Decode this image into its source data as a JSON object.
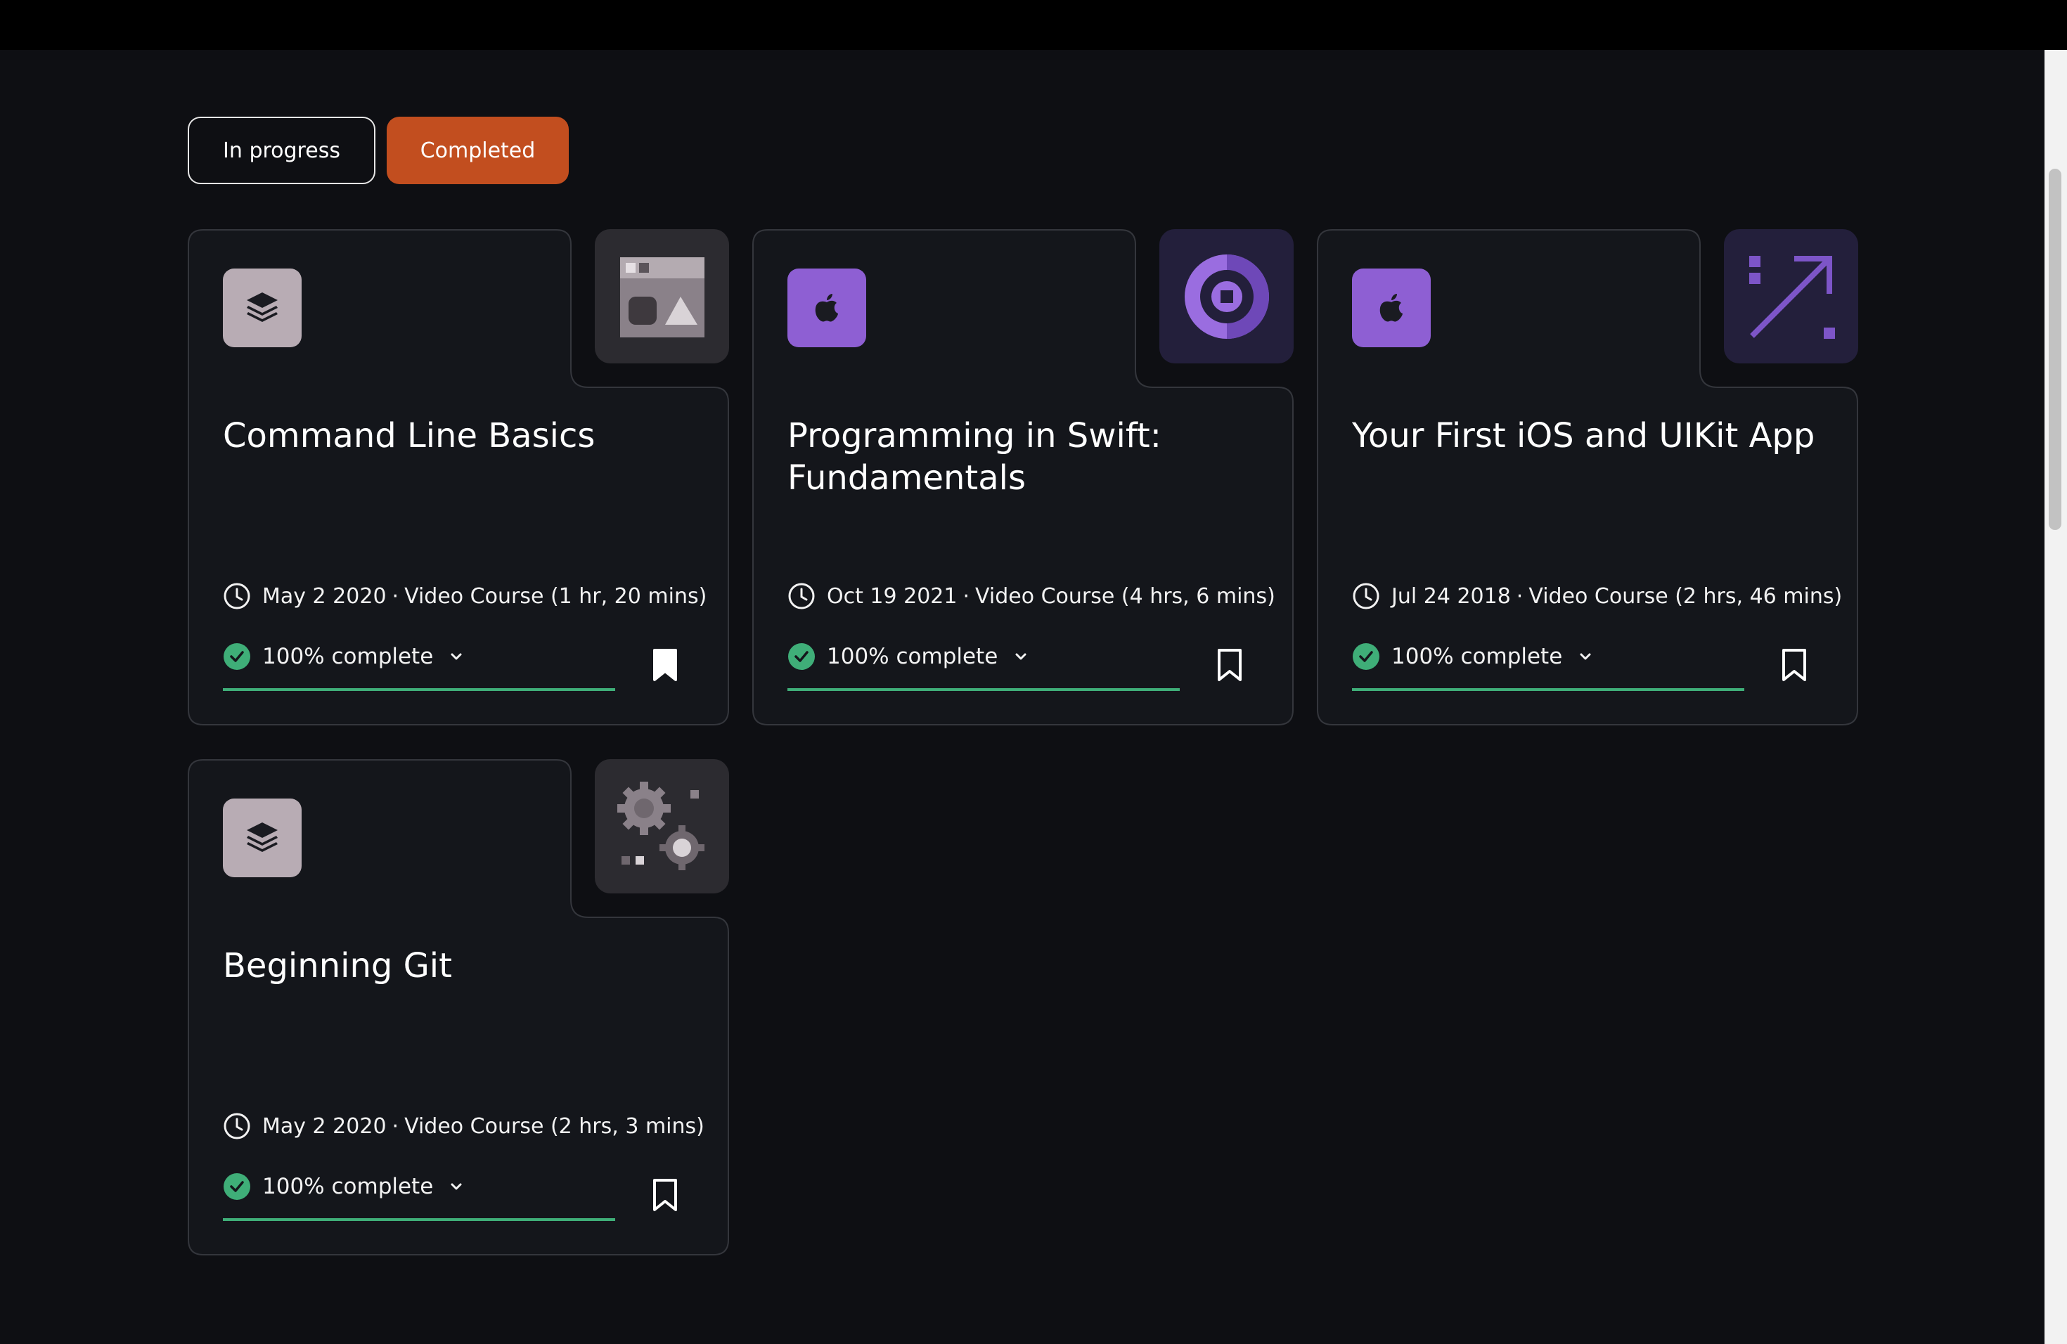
{
  "tabs": {
    "in_progress": "In progress",
    "completed": "Completed",
    "active": "completed"
  },
  "colors": {
    "background": "#0e0f13",
    "accent": "#c24e1f",
    "progress": "#3fae78",
    "apple_purple": "#8e5fd3",
    "stack_mauve": "#b8acb4"
  },
  "courses": [
    {
      "title": "Command Line Basics",
      "category_icon": "stack-icon",
      "thumbnail": "window-shapes-icon",
      "date": "May 2 2020",
      "separator": "·",
      "kind": "Video Course (1 hr, 20 mins)",
      "progress_label": "100% complete",
      "progress_fraction": 1.0,
      "bookmarked": true
    },
    {
      "title": "Programming in Swift: Fundamentals",
      "category_icon": "apple-icon",
      "thumbnail": "target-circle-icon",
      "date": "Oct 19 2021",
      "separator": "·",
      "kind": "Video Course (4 hrs, 6 mins)",
      "progress_label": "100% complete",
      "progress_fraction": 1.0,
      "bookmarked": false
    },
    {
      "title": "Your First iOS and UIKit App",
      "category_icon": "apple-icon",
      "thumbnail": "diagonal-arrow-icon",
      "date": "Jul 24 2018",
      "separator": "·",
      "kind": "Video Course (2 hrs, 46 mins)",
      "progress_label": "100% complete",
      "progress_fraction": 1.0,
      "bookmarked": false
    },
    {
      "title": "Beginning Git",
      "category_icon": "stack-icon",
      "thumbnail": "gears-icon",
      "date": "May 2 2020",
      "separator": "·",
      "kind": "Video Course (2 hrs, 3 mins)",
      "progress_label": "100% complete",
      "progress_fraction": 1.0,
      "bookmarked": false
    }
  ]
}
